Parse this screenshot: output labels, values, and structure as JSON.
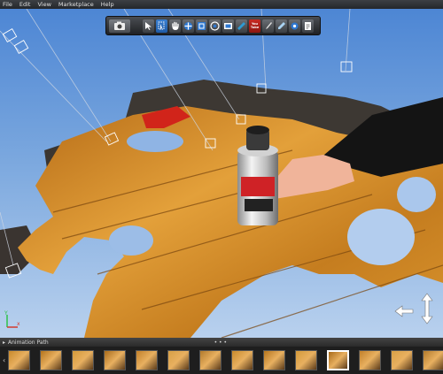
{
  "menubar": {
    "items": [
      {
        "label": "File"
      },
      {
        "label": "Edit"
      },
      {
        "label": "View"
      },
      {
        "label": "Marketplace"
      },
      {
        "label": "Help"
      }
    ]
  },
  "toolbar": {
    "tools": [
      {
        "icon": "camera-icon"
      },
      {
        "icon": "select-pointer-icon"
      },
      {
        "icon": "select-region-icon"
      },
      {
        "icon": "hand-pan-icon"
      },
      {
        "icon": "move-icon"
      },
      {
        "icon": "scale-icon"
      },
      {
        "icon": "rotate-camera-icon"
      },
      {
        "icon": "frame-icon"
      },
      {
        "icon": "measure-icon"
      },
      {
        "icon": "youtube-icon",
        "label": "You Tube"
      },
      {
        "icon": "brush-icon"
      },
      {
        "icon": "eyedropper-icon"
      },
      {
        "icon": "settings-icon"
      },
      {
        "icon": "export-icon"
      }
    ],
    "accent_color": "#2d6fc2"
  },
  "viewport": {
    "axis_labels": {
      "x": "x",
      "y": "Y"
    }
  },
  "panel": {
    "title": "Animation Path",
    "handle": "• • •"
  },
  "filmstrip": {
    "nav_prev": "‹",
    "nav_next": "›",
    "thumbnail_count": 14,
    "selected_index": 10
  }
}
